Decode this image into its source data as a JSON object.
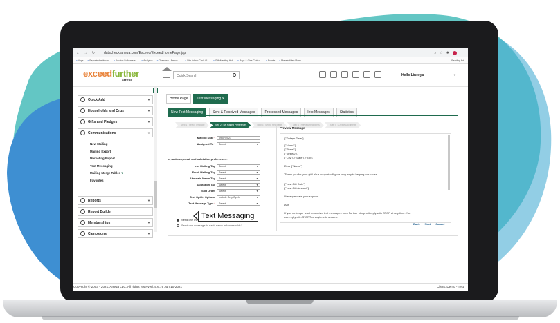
{
  "colors": {
    "blob_teal": "#63c6c4",
    "blob_blue": "#3e8fd2",
    "brand_orange": "#e9843b",
    "brand_green": "#8ab73c",
    "accent_dark_green": "#1f6b4e"
  },
  "browser": {
    "url": "datacheck.arreva.com/Exceed/ExceedHomePage.jsp",
    "bookmarks": [
      "Apps",
      "Reports dashboard",
      "Auction Software a...",
      "Analytics",
      "Overview - Arreva -...",
      "Site Admin Can't Cl...",
      "GiftsMeeting Hub",
      "Boys & Girls Club o...",
      "Events",
      "MaestroWeb Video..."
    ],
    "reading_list": "Reading list"
  },
  "header": {
    "logo_part1": "exceed",
    "logo_part2": "further",
    "logo_sub": "arreva",
    "search_placeholder": "Quick Search",
    "greeting": "Hello Lineeya"
  },
  "sidebar": {
    "items_top": [
      {
        "label": "Quick Add",
        "icon": "plus-circle-icon"
      },
      {
        "label": "Households and Orgs",
        "icon": "household-icon"
      },
      {
        "label": "Gifts and Pledges",
        "icon": "gift-icon"
      },
      {
        "label": "Communications",
        "icon": "message-icon"
      }
    ],
    "sub_items": [
      "New Mailing",
      "Mailing Export",
      "Marketing Export",
      "Text Messaging",
      "Mailing Merge Tables",
      "Favorites"
    ],
    "items_bottom": [
      {
        "label": "Reports",
        "icon": "report-icon"
      },
      {
        "label": "Report Builder",
        "icon": "builder-icon"
      },
      {
        "label": "Memberships",
        "icon": "membership-icon"
      },
      {
        "label": "Campaigns",
        "icon": "campaign-icon"
      }
    ]
  },
  "callout": {
    "label": "Text Messaging"
  },
  "tabs_top": [
    "Home Page",
    "Text Messaging"
  ],
  "tabs_secondary": [
    "New Text Messaging",
    "Sent & Received Messages",
    "Processed Messages",
    "Info Messages",
    "Statistics"
  ],
  "steps": [
    "Step 1 : Select Template",
    "Step 2 : Set Mailing Preferences",
    "Step 3 : Select Recipients",
    "Step 4 : Preview Recipients",
    "Step 5 : Create Documents"
  ],
  "form": {
    "mailing_date_label": "Mailing Date",
    "mailing_date_value": "09/07/2021",
    "assigned_to_label": "Assigned To",
    "assigned_to_value": "Select",
    "pref_heading": "e, address, email and salutation preferences:",
    "rows": [
      {
        "label": "ess Mailing Tag",
        "value": "Select",
        "req": ""
      },
      {
        "label": "Email Mailing Tag",
        "value": "Select",
        "req": ""
      },
      {
        "label": "Alternate Name Tag",
        "value": "Select",
        "req": ""
      },
      {
        "label": "Salutation Tag",
        "value": "Select",
        "req": ""
      },
      {
        "label": "Sort Order",
        "value": "Select",
        "req": ""
      },
      {
        "label": "Text Opt-In Options",
        "value": "Include Only Opt-In",
        "req": ""
      },
      {
        "label": "Text Message Type",
        "value": "Select",
        "req": "*"
      }
    ],
    "radio_1": "Send one message per Household / Organization",
    "radio_2": "Send one message to each name in Household /"
  },
  "preview": {
    "title": "Preview Message",
    "lines": [
      "{\"Todays Date\"}",
      "{\"Name\"}",
      "{\"Street\"}",
      "{\"Street2\"}",
      "{\"City\"},{\"State\"} {\"Zip\"}",
      "Dear {\"Name\"}",
      "Thank you for your gift! Your support will go a long way to helping our cause.",
      "{\"Last Gift Date\"}",
      "{\"Last Gift Amount\"}",
      "We appreciate your support.",
      "Ann",
      "If you no longer want to receive text messages from Further Nonprofit reply with STOP at any time. You",
      "can reply with START at anytime to resume."
    ],
    "buttons": [
      "Back",
      "Next",
      "Cancel"
    ]
  },
  "footer": {
    "copyright": "Copyright © 2003 - 2021. Arreva LLC. All rights reserved.   5.6.79 Jun-10-2021",
    "client": "Client: Demo - Test"
  }
}
